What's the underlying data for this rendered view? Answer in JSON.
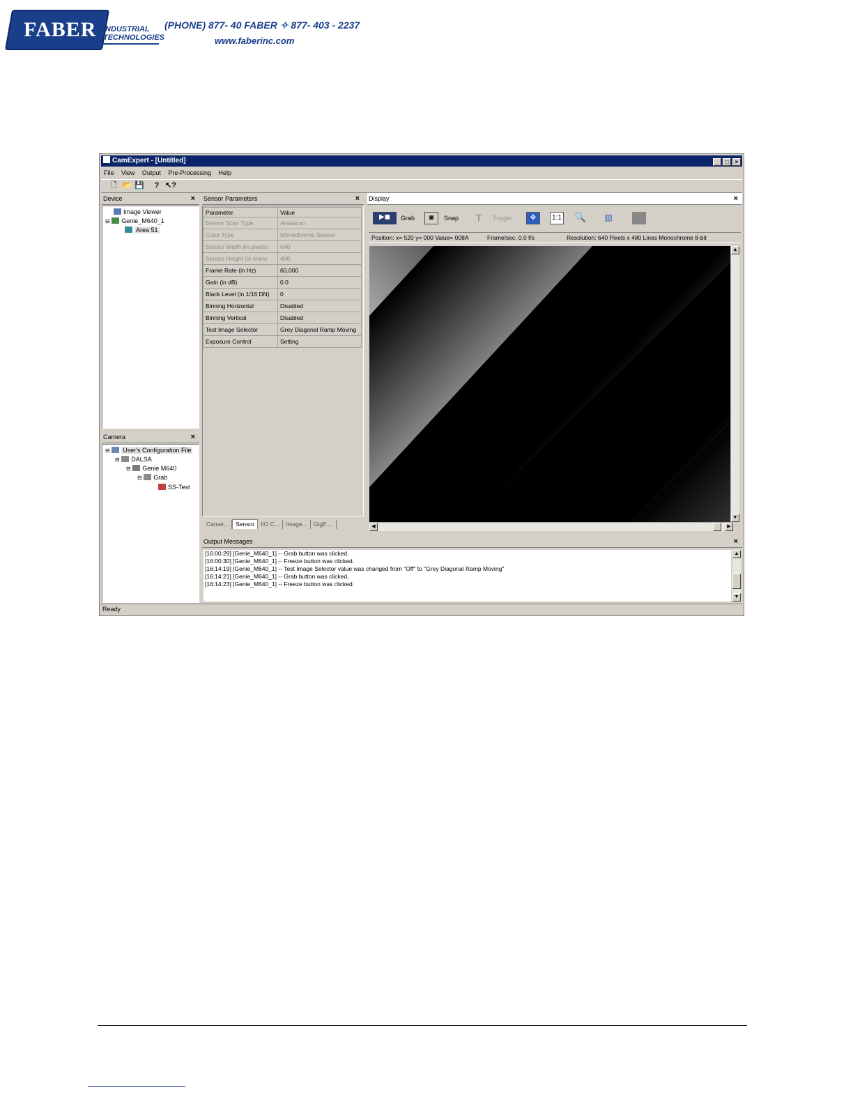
{
  "header": {
    "logo_text": "FABER",
    "logo_sub_line1": "INDUSTRIAL",
    "logo_sub_line2": "TECHNOLOGIES",
    "contact": "(PHONE) 877- 40 FABER  ✧  877- 403 - 2237",
    "website": "www.faberinc.com"
  },
  "window": {
    "title": "CamExpert - [Untitled]",
    "menu": [
      "File",
      "View",
      "Output",
      "Pre-Processing",
      "Help"
    ],
    "status": "Ready"
  },
  "device_panel": {
    "title": "Device",
    "items": [
      "Image Viewer",
      "Genie_M640_1",
      "Area 51"
    ]
  },
  "camera_panel": {
    "title": "Camera",
    "items": [
      "User's Configuration File",
      "DALSA",
      "Genie M640",
      "Grab",
      "SS-Test"
    ]
  },
  "sensor_panel": {
    "title": "Sensor Parameters",
    "col_param": "Parameter",
    "col_value": "Value",
    "rows": [
      {
        "param": "Device Scan Type",
        "value": "Areascan",
        "disabled": true
      },
      {
        "param": "Color Type",
        "value": "Monochrome Sensor",
        "disabled": true
      },
      {
        "param": "Sensor Width (in pixels)",
        "value": "640",
        "disabled": true
      },
      {
        "param": "Sensor Height (in lines)",
        "value": "480",
        "disabled": true
      },
      {
        "param": "Frame Rate (in Hz)",
        "value": "60.000",
        "disabled": false
      },
      {
        "param": "Gain (in dB)",
        "value": "0.0",
        "disabled": false
      },
      {
        "param": "Black Level (in 1/16 DN)",
        "value": "0",
        "disabled": false
      },
      {
        "param": "Binning Horizontal",
        "value": "Disabled",
        "disabled": false
      },
      {
        "param": "Binning Vertical",
        "value": "Disabled",
        "disabled": false
      },
      {
        "param": "Test Image Selector",
        "value": "Grey Diagonal Ramp Moving",
        "disabled": false
      },
      {
        "param": "Exposure Control",
        "value": "Setting",
        "disabled": false
      }
    ],
    "tabs": [
      "Camer...",
      "Sensor",
      "I/O C...",
      "Image...",
      "GigE ..."
    ]
  },
  "display_panel": {
    "title": "Display",
    "grab_label": "Grab",
    "snap_label": "Snap",
    "trigger_label": "Trigger",
    "one_to_one": "1:1",
    "position": "Position:  x= 520 y= 000 Value= 008A",
    "frame_rate": "Frame/sec:  0.0 f/s",
    "resolution": "Resolution:    640 Pixels x 480 Lines   Monochrome 8-bit"
  },
  "output_panel": {
    "title": "Output Messages",
    "messages": [
      "[16:00:29] [Genie_M640_1]  -- Grab button was clicked.",
      "[16:00:30] [Genie_M640_1]  -- Freeze button was clicked.",
      "[16:14:19] [Genie_M640_1]  -- Test Image Selector value was changed from \"Off\" to \"Grey Diagonal Ramp Moving\"",
      "[16:14:21] [Genie_M640_1]  -- Grab button was clicked.",
      "[16:14:23] [Genie_M640_1]  -- Freeze button was clicked."
    ]
  }
}
